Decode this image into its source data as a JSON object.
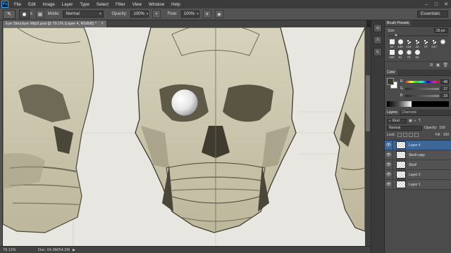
{
  "menubar": {
    "logo": "Ps",
    "items": [
      "File",
      "Edit",
      "Image",
      "Layer",
      "Type",
      "Select",
      "Filter",
      "View",
      "Window",
      "Help"
    ]
  },
  "options_bar": {
    "brush_size": "8",
    "mode_label": "Mode:",
    "mode_value": "Normal",
    "opacity_label": "Opacity:",
    "opacity_value": "100%",
    "flow_label": "Flow:",
    "flow_value": "100%",
    "workspace": "Essentials"
  },
  "document_tab": {
    "title": "Eye Structure Wip2.psd @ 79.1% (Layer 4, RGB/8) *"
  },
  "status_bar": {
    "zoom": "79.12%",
    "doc_size": "Doc: 64.3M/54.2M"
  },
  "brush_presets": {
    "tab_label": "Brush Presets",
    "size_label": "Size",
    "size_value": "25 px",
    "sizes_row1": [
      "30",
      "100",
      "116",
      "40",
      "70",
      "447"
    ],
    "sizes_row2": [
      "200",
      "91",
      "70",
      "60"
    ]
  },
  "color_panel": {
    "tab_label": "Color",
    "r": "48",
    "g": "27",
    "b": "29",
    "fg_color": "#3a3a2e",
    "bg_color": "#ffffff"
  },
  "layers_panel": {
    "tabs": [
      "Layers",
      "Channels"
    ],
    "kind_label": "Kind",
    "blend_mode": "Normal",
    "opacity_label": "Opacity:",
    "opacity_value": "100",
    "lock_label": "Lock:",
    "fill_label": "Fill:",
    "fill_value": "100",
    "layers": [
      {
        "name": "Layer 4",
        "selected": true
      },
      {
        "name": "Skull copy",
        "selected": false
      },
      {
        "name": "Skull",
        "selected": false
      },
      {
        "name": "Layer 2",
        "selected": false
      },
      {
        "name": "Layer 1",
        "selected": false
      }
    ]
  },
  "colors": {
    "skull_fill": "#cfcab1",
    "skull_shadow": "#8f8a72",
    "accent_selected": "#3d6699"
  }
}
